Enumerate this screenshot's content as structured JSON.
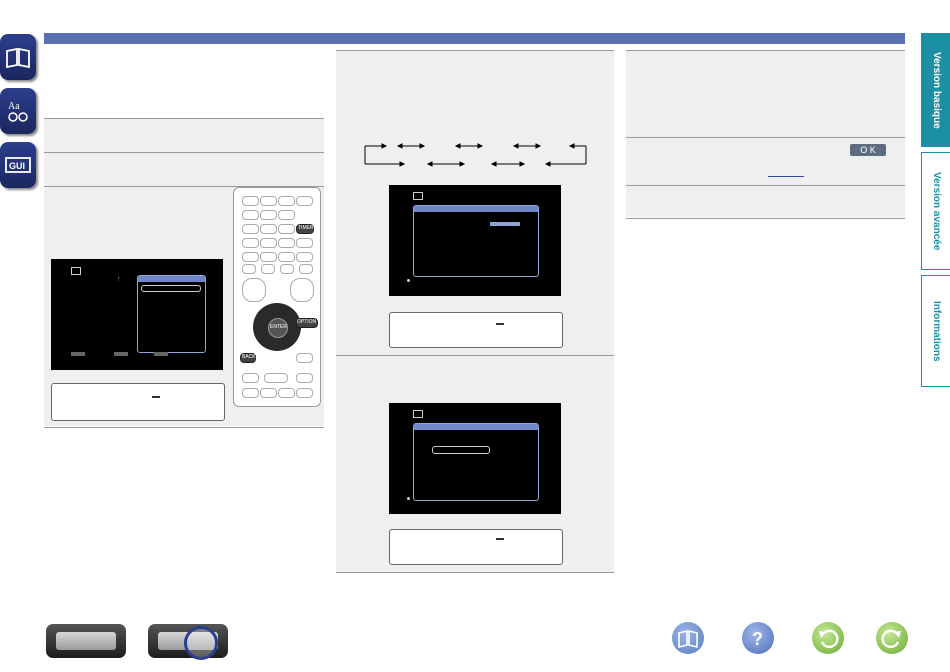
{
  "tabs": {
    "basic": "Version basique",
    "advanced": "Version avancée",
    "info": "Informations"
  },
  "left_icons": [
    "manual-book-icon",
    "font-settings-icon",
    "gui-icon"
  ],
  "right_box_ok_label": "O K",
  "colors": {
    "top_bar": "#5b6fb3",
    "tab_accent": "#1d8fa3",
    "left_tab": "#2d3e8c",
    "bottom_book": "#5b7fc0",
    "bottom_help": "#4d6fb5",
    "bottom_back": "#6aab2e",
    "bottom_forward": "#6aab2e"
  },
  "bottom_icons": [
    "manual-book-icon",
    "help-icon",
    "back-icon",
    "forward-icon"
  ],
  "remote_labels": {
    "timer": "TIMER",
    "option": "OPTION",
    "enter": "ENTER",
    "back": "BACK"
  }
}
